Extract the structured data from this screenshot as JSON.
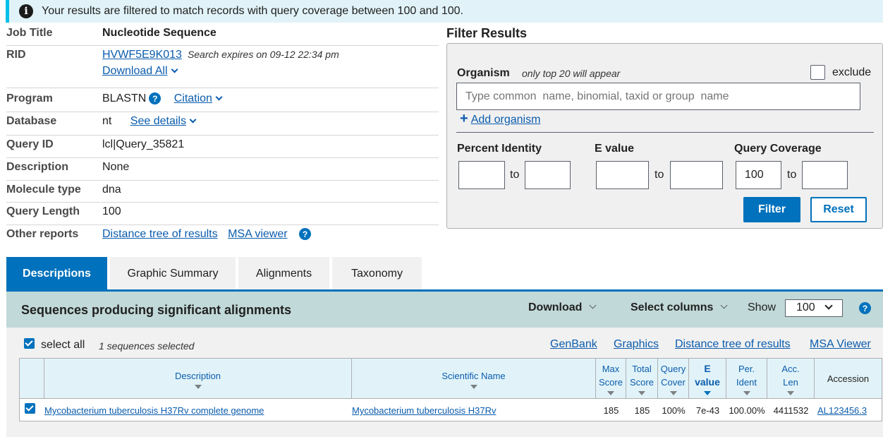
{
  "banner": {
    "text": "Your results are filtered to match records with query coverage between 100 and 100."
  },
  "summary": {
    "job_title_label": "Job Title",
    "job_title": "Nucleotide Sequence",
    "rid_label": "RID",
    "rid": "HVWF5E9K013",
    "expires": "Search expires on 09-12 22:34 pm",
    "download_all": "Download All",
    "program_label": "Program",
    "program": "BLASTN",
    "citation": "Citation",
    "database_label": "Database",
    "database": "nt",
    "see_details": "See details",
    "query_id_label": "Query ID",
    "query_id": "lcl|Query_35821",
    "description_label": "Description",
    "description": "None",
    "molecule_label": "Molecule type",
    "molecule": "dna",
    "length_label": "Query Length",
    "length": "100",
    "other_label": "Other reports",
    "distance_tree": "Distance tree of results",
    "msa_viewer": "MSA viewer"
  },
  "filter": {
    "title": "Filter Results",
    "organism_label": "Organism",
    "organism_hint": "only top 20 will appear",
    "exclude_label": "exclude",
    "organism_placeholder": "Type common  name, binomial, taxid or group  name",
    "add_organism": "Add organism",
    "percent_identity_label": "Percent Identity",
    "evalue_label": "E value",
    "query_coverage_label": "Query Coverage",
    "to": "to",
    "percent_identity_from": "",
    "percent_identity_to": "",
    "evalue_from": "",
    "evalue_to": "",
    "coverage_from": "100",
    "coverage_to": "",
    "filter_button": "Filter",
    "reset_button": "Reset"
  },
  "tabs": [
    {
      "label": "Descriptions",
      "active": true
    },
    {
      "label": "Graphic Summary",
      "active": false
    },
    {
      "label": "Alignments",
      "active": false
    },
    {
      "label": "Taxonomy",
      "active": false
    }
  ],
  "results": {
    "title": "Sequences producing significant alignments",
    "download": "Download",
    "select_columns": "Select columns",
    "show_label": "Show",
    "show_value": "100",
    "select_all": "select all",
    "selected_count": "1 sequences selected",
    "links": {
      "genbank": "GenBank",
      "graphics": "Graphics",
      "distance_tree": "Distance tree of results",
      "msa_viewer": "MSA Viewer"
    },
    "columns": {
      "description": "Description",
      "scientific_name": "Scientific Name",
      "max_score_1": "Max",
      "max_score_2": "Score",
      "total_score_1": "Total",
      "total_score_2": "Score",
      "query_cover_1": "Query",
      "query_cover_2": "Cover",
      "evalue_1": "E",
      "evalue_2": "value",
      "per_ident_1": "Per.",
      "per_ident_2": "Ident",
      "acc_len_1": "Acc.",
      "acc_len_2": "Len",
      "accession": "Accession"
    },
    "rows": [
      {
        "description": "Mycobacterium tuberculosis H37Rv complete genome",
        "scientific_name": "Mycobacterium tuberculosis H37Rv",
        "max_score": "185",
        "total_score": "185",
        "query_cover": "100%",
        "evalue": "7e-43",
        "per_ident": "100.00%",
        "acc_len": "4411532",
        "accession": "AL123456.3"
      }
    ]
  },
  "colors": {
    "primary": "#0071bc",
    "link": "#0b5cad",
    "banner_bg": "#e1f3f8",
    "banner_accent": "#02bfe7",
    "results_header_bg": "#c1d9d8"
  }
}
